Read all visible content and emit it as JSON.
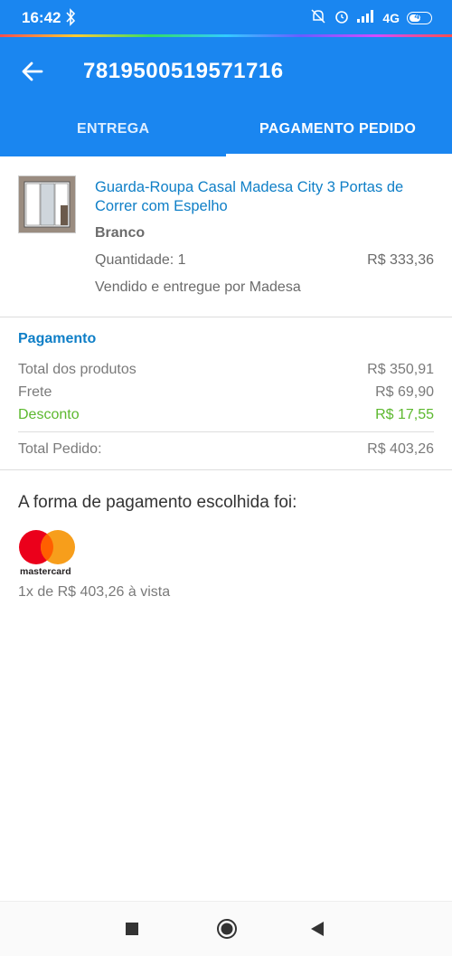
{
  "status_bar": {
    "time": "16:42",
    "network": "4G",
    "battery": "41"
  },
  "header": {
    "order_number": "7819500519571716"
  },
  "tabs": [
    {
      "label": "ENTREGA",
      "active": false
    },
    {
      "label": "PAGAMENTO PEDIDO",
      "active": true
    }
  ],
  "product": {
    "title": "Guarda-Roupa Casal Madesa City 3 Portas de Correr com Espelho",
    "color": "Branco",
    "quantity": "Quantidade: 1",
    "price": "R$ 333,36",
    "seller": "Vendido e entregue por Madesa"
  },
  "payment": {
    "title": "Pagamento",
    "rows": [
      {
        "label": "Total dos produtos",
        "value": "R$ 350,91"
      },
      {
        "label": "Frete",
        "value": "R$ 69,90"
      },
      {
        "label": "Desconto",
        "value": "R$ 17,55"
      }
    ],
    "total_label": "Total Pedido:",
    "total_value": "R$ 403,26"
  },
  "method": {
    "title": "A forma de pagamento escolhida foi:",
    "card_brand": "mastercard",
    "installment": "1x de R$ 403,26 à vista"
  },
  "colors": {
    "primary": "#1a86f0",
    "link": "#0f7fc7",
    "discount": "#5cb82e"
  }
}
